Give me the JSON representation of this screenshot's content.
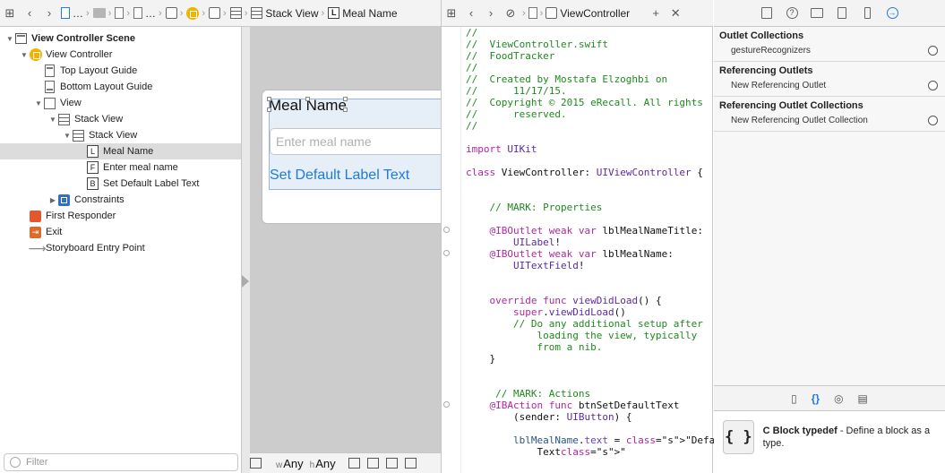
{
  "jumpbar_left": {
    "crumbs": [
      "…",
      "…",
      "Stack View",
      "Meal Name"
    ]
  },
  "jumpbar_mid": {
    "file": "ViewController"
  },
  "outline": {
    "rows": [
      {
        "label": "View Controller Scene",
        "icon": "scene-icon"
      },
      {
        "label": "View Controller",
        "icon": "view-controller-icon"
      },
      {
        "label": "Top Layout Guide",
        "icon": "layout-guide-icon"
      },
      {
        "label": "Bottom Layout Guide",
        "icon": "layout-guide-icon"
      },
      {
        "label": "View",
        "icon": "view-icon"
      },
      {
        "label": "Stack View",
        "icon": "stack-view-icon"
      },
      {
        "label": "Stack View",
        "icon": "stack-view-icon"
      },
      {
        "label": "Meal Name",
        "icon": "label-icon"
      },
      {
        "label": "Enter meal name",
        "icon": "textfield-icon"
      },
      {
        "label": "Set Default Label Text",
        "icon": "button-icon"
      },
      {
        "label": "Constraints",
        "icon": "constraints-icon"
      },
      {
        "label": "First Responder",
        "icon": "first-responder-icon"
      },
      {
        "label": "Exit",
        "icon": "exit-icon"
      },
      {
        "label": "Storyboard Entry Point",
        "icon": "entry-arrow-icon"
      }
    ],
    "filter_placeholder": "Filter"
  },
  "canvas": {
    "label_text": "Meal Name",
    "input_placeholder": "Enter meal name",
    "button_text": "Set Default Label Text",
    "size_w": "Any",
    "size_h": "Any",
    "size_w_prefix": "w",
    "size_h_prefix": "h"
  },
  "code_lines": [
    "//",
    "//  ViewController.swift",
    "//  FoodTracker",
    "//",
    "//  Created by Mostafa Elzoghbi on",
    "//      11/17/15.",
    "//  Copyright © 2015 eRecall. All rights",
    "//      reserved.",
    "//",
    "",
    "import UIKit",
    "",
    "class ViewController: UIViewController {",
    "",
    "",
    "    // MARK: Properties",
    "",
    "    @IBOutlet weak var lblMealNameTitle:",
    "        UILabel!",
    "    @IBOutlet weak var lblMealName:",
    "        UITextField!",
    "",
    "",
    "    override func viewDidLoad() {",
    "        super.viewDidLoad()",
    "        // Do any additional setup after",
    "            loading the view, typically",
    "            from a nib.",
    "    }",
    "",
    "",
    "     // MARK: Actions",
    "    @IBAction func btnSetDefaultText",
    "        (sender: UIButton) {",
    "",
    "        lblMealName.text = \"Default",
    "            Text\""
  ],
  "inspector": {
    "sections": [
      {
        "title": "Outlet Collections",
        "rows": [
          "gestureRecognizers"
        ]
      },
      {
        "title": "Referencing Outlets",
        "rows": [
          "New Referencing Outlet"
        ]
      },
      {
        "title": "Referencing Outlet Collections",
        "rows": [
          "New Referencing Outlet Collection"
        ]
      }
    ]
  },
  "library": {
    "item_icon_text": "{ }",
    "item_title": "C Block typedef",
    "item_desc": " - Define a block as a type."
  },
  "colors": {
    "accent": "#1f7ae0",
    "comment": "#1f8a1f",
    "keyword": "#b0279e",
    "string": "#c4251a"
  }
}
